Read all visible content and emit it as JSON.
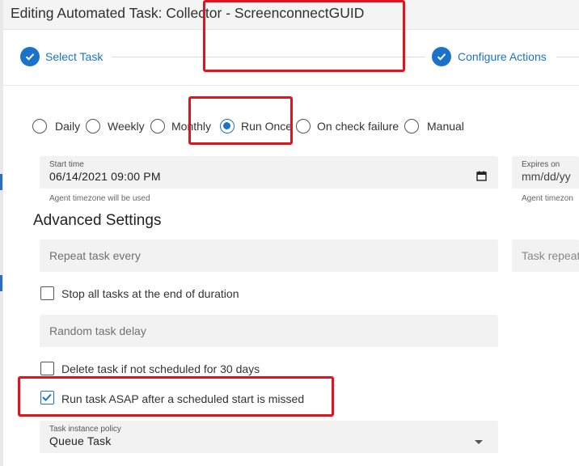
{
  "dialog": {
    "title": "Editing Automated Task: Collector - ScreenconnectGUID"
  },
  "stepper": {
    "steps": [
      {
        "label": "Select Task",
        "state": "complete"
      },
      {
        "label": "Configure Actions",
        "state": "complete"
      }
    ]
  },
  "schedule": {
    "options": [
      {
        "label": "Daily",
        "checked": false
      },
      {
        "label": "Weekly",
        "checked": false
      },
      {
        "label": "Monthly",
        "checked": false
      },
      {
        "label": "Run Once",
        "checked": true
      },
      {
        "label": "On check failure",
        "checked": false
      },
      {
        "label": "Manual",
        "checked": false
      }
    ],
    "start_time": {
      "label": "Start time",
      "value": "06/14/2021 09:00 PM",
      "helper": "Agent timezone will be used"
    },
    "expires_on": {
      "label": "Expires on",
      "placeholder": "mm/dd/yy",
      "helper": "Agent timezon"
    }
  },
  "advanced": {
    "title": "Advanced Settings",
    "repeat_task_every": {
      "placeholder": "Repeat task every"
    },
    "task_repeat": {
      "placeholder": "Task repeat"
    },
    "stop_all_tasks": {
      "label": "Stop all tasks at the end of duration",
      "checked": false
    },
    "random_task_delay": {
      "placeholder": "Random task delay"
    },
    "delete_task": {
      "label": "Delete task if not scheduled for 30 days",
      "checked": false
    },
    "run_asap": {
      "label": "Run task ASAP after a scheduled start is missed",
      "checked": true
    },
    "task_instance_policy": {
      "label": "Task instance policy",
      "value": "Queue Task"
    }
  },
  "colors": {
    "accent": "#1a73c9",
    "highlight": "#e0141e",
    "field_bg": "#f2f2f2"
  }
}
